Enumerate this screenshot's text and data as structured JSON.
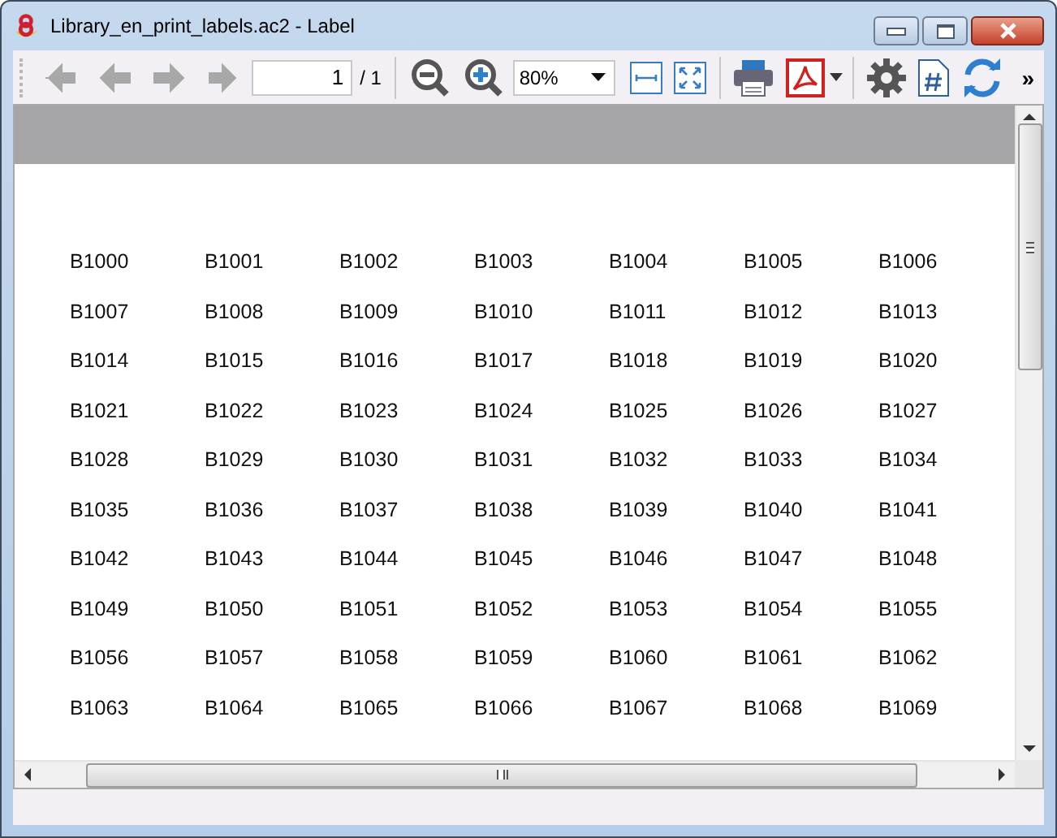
{
  "window": {
    "title": "Library_en_print_labels.ac2 - Label"
  },
  "toolbar": {
    "nav_buttons": [
      {
        "kind": "first",
        "disabled": true
      },
      {
        "kind": "prev",
        "disabled": true
      },
      {
        "kind": "next",
        "disabled": true
      },
      {
        "kind": "last",
        "disabled": true
      }
    ],
    "page_field": {
      "value": "1"
    },
    "page_total": "/ 1",
    "zoom_select": {
      "value": "80%"
    },
    "overflow": "»"
  },
  "labels": [
    "B1000",
    "B1001",
    "B1002",
    "B1003",
    "B1004",
    "B1005",
    "B1006",
    "B1007",
    "B1008",
    "B1009",
    "B1010",
    "B1011",
    "B1012",
    "B1013",
    "B1014",
    "B1015",
    "B1016",
    "B1017",
    "B1018",
    "B1019",
    "B1020",
    "B1021",
    "B1022",
    "B1023",
    "B1024",
    "B1025",
    "B1026",
    "B1027",
    "B1028",
    "B1029",
    "B1030",
    "B1031",
    "B1032",
    "B1033",
    "B1034",
    "B1035",
    "B1036",
    "B1037",
    "B1038",
    "B1039",
    "B1040",
    "B1041",
    "B1042",
    "B1043",
    "B1044",
    "B1045",
    "B1046",
    "B1047",
    "B1048",
    "B1049",
    "B1050",
    "B1051",
    "B1052",
    "B1053",
    "B1054",
    "B1055",
    "B1056",
    "B1057",
    "B1058",
    "B1059",
    "B1060",
    "B1061",
    "B1062",
    "B1063",
    "B1064",
    "B1065",
    "B1066",
    "B1067",
    "B1068",
    "B1069"
  ]
}
